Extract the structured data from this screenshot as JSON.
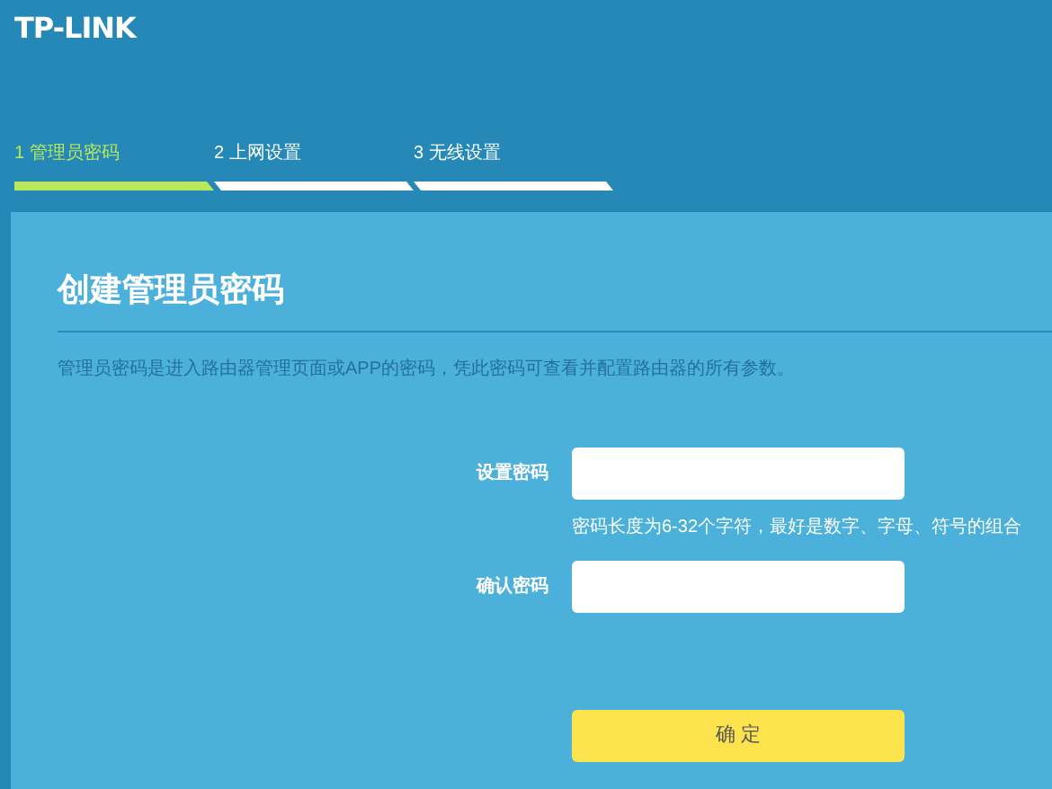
{
  "logo": "TP-LINK",
  "steps": [
    {
      "label": "1 管理员密码",
      "selected": true
    },
    {
      "label": "2 上网设置",
      "selected": false
    },
    {
      "label": "3 无线设置",
      "selected": false
    }
  ],
  "title": "创建管理员密码",
  "description": "管理员密码是进入路由器管理页面或APP的密码，凭此密码可查看并配置路由器的所有参数。",
  "fields": [
    {
      "label": "设置密码",
      "hint": "密码长度为6-32个字符，最好是数字、字母、符号的组合"
    },
    {
      "label": "确认密码"
    }
  ],
  "button": "确 定"
}
